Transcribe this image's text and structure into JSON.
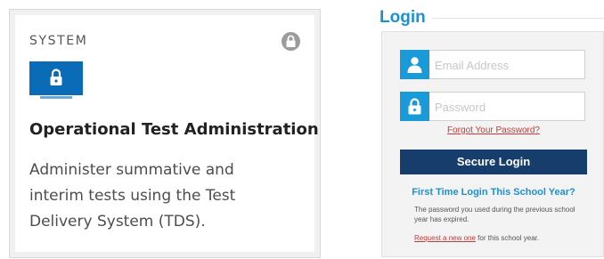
{
  "system_card": {
    "label": "SYSTEM",
    "title": "Operational Test Administration",
    "description": "Administer summative and interim tests using the Test Delivery System (TDS).",
    "icons": {
      "status": "lock-icon",
      "hero": "lock-monitor-icon"
    }
  },
  "login": {
    "title": "Login",
    "email": {
      "placeholder": "Email Address",
      "value": "",
      "icon": "user-icon"
    },
    "password": {
      "placeholder": "Password",
      "value": "",
      "icon": "lock-icon"
    },
    "forgot_link": "Forgot Your Password?",
    "submit_label": "Secure Login",
    "first_time_heading": "First Time Login This School Year?",
    "expired_note": "The password you used during the previous school year has expired.",
    "request_link": "Request a new one",
    "request_suffix": " for this school year."
  },
  "colors": {
    "accent_blue": "#1a91d4",
    "button_navy": "#163d6b",
    "link_red": "#c23b3b",
    "hero_blue": "#0a6bb6"
  }
}
